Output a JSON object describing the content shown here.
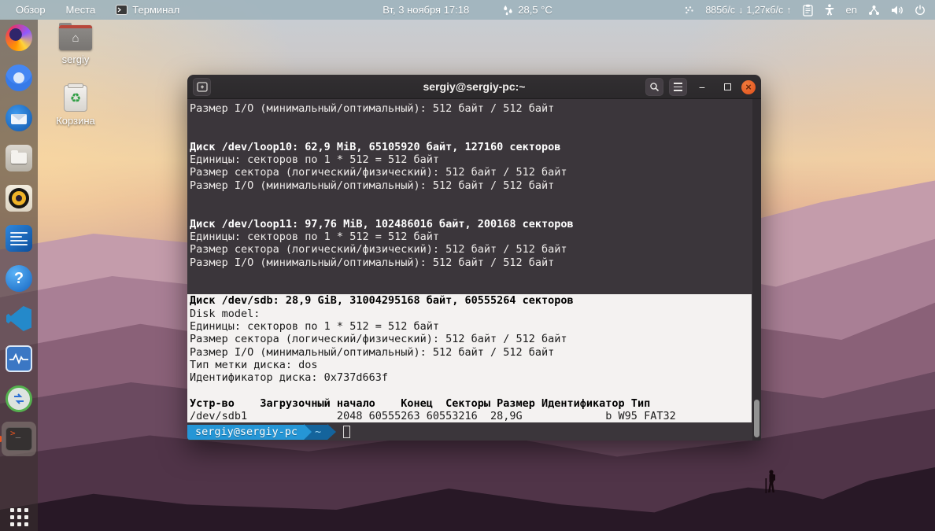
{
  "top_bar": {
    "activities": "Обзор",
    "places": "Места",
    "app_menu": "Терминал",
    "clock": "Вт, 3 ноября 17:18",
    "temperature": "28,5 °C",
    "net_down": "885б/с",
    "net_down_arrow": "↓",
    "net_up": "1,27кб/с",
    "net_up_arrow": "↑",
    "keyboard_layout": "en"
  },
  "desktop": {
    "icons": [
      {
        "label": "sergiy",
        "icon": "home-folder-icon",
        "glyph": "⌂"
      },
      {
        "label": "Корзина",
        "icon": "trash-icon",
        "glyph": "♻"
      }
    ]
  },
  "dock": {
    "items": [
      "firefox",
      "chromium",
      "thunderbird",
      "files",
      "rhythmbox",
      "libreoffice-writer",
      "help",
      "vscode",
      "system-monitor",
      "screen-recorder",
      "terminal",
      "app-grid"
    ],
    "terminal_glyph_prompt": ">",
    "terminal_glyph_line": "_",
    "help_glyph": "?"
  },
  "window_controls": {
    "minimize": "−",
    "close": "×"
  },
  "terminal": {
    "title": "sergiy@sergiy-pc:~",
    "prompt": {
      "user_host": "sergiy@sergiy-pc",
      "path_symbol": "~"
    },
    "colors": {
      "background": "#3b363b",
      "titlebar": "#2e2b2e",
      "selection_bg": "#f4f2f1",
      "close_button": "#e95420",
      "prompt_bg": "#2596d6"
    },
    "lines": [
      {
        "t": "Размер I/O (минимальный/оптимальный): 512 байт / 512 байт"
      },
      {
        "t": ""
      },
      {
        "t": ""
      },
      {
        "t": "Диск /dev/loop10: 62,9 MiB, 65105920 байт, 127160 секторов",
        "b": true
      },
      {
        "t": "Единицы: секторов по 1 * 512 = 512 байт"
      },
      {
        "t": "Размер сектора (логический/физический): 512 байт / 512 байт"
      },
      {
        "t": "Размер I/O (минимальный/оптимальный): 512 байт / 512 байт"
      },
      {
        "t": ""
      },
      {
        "t": ""
      },
      {
        "t": "Диск /dev/loop11: 97,76 MiB, 102486016 байт, 200168 секторов",
        "b": true
      },
      {
        "t": "Единицы: секторов по 1 * 512 = 512 байт"
      },
      {
        "t": "Размер сектора (логический/физический): 512 байт / 512 байт"
      },
      {
        "t": "Размер I/O (минимальный/оптимальный): 512 байт / 512 байт"
      },
      {
        "t": ""
      },
      {
        "t": ""
      },
      {
        "t": "Диск /dev/sdb: 28,9 GiB, 31004295168 байт, 60555264 секторов",
        "b": true,
        "s": true
      },
      {
        "t": "Disk model:",
        "s": true
      },
      {
        "t": "Единицы: секторов по 1 * 512 = 512 байт",
        "s": true
      },
      {
        "t": "Размер сектора (логический/физический): 512 байт / 512 байт",
        "s": true
      },
      {
        "t": "Размер I/O (минимальный/оптимальный): 512 байт / 512 байт",
        "s": true
      },
      {
        "t": "Тип метки диска: dos",
        "s": true
      },
      {
        "t": "Идентификатор диска: 0x737d663f",
        "s": true
      },
      {
        "t": "",
        "s": true
      },
      {
        "t": "Устр-во    Загрузочный начало    Конец  Секторы Размер Идентификатор Тип",
        "b": true,
        "s": true
      },
      {
        "t": "/dev/sdb1              2048 60555263 60553216  28,9G             b W95 FAT32",
        "s": true
      }
    ]
  }
}
